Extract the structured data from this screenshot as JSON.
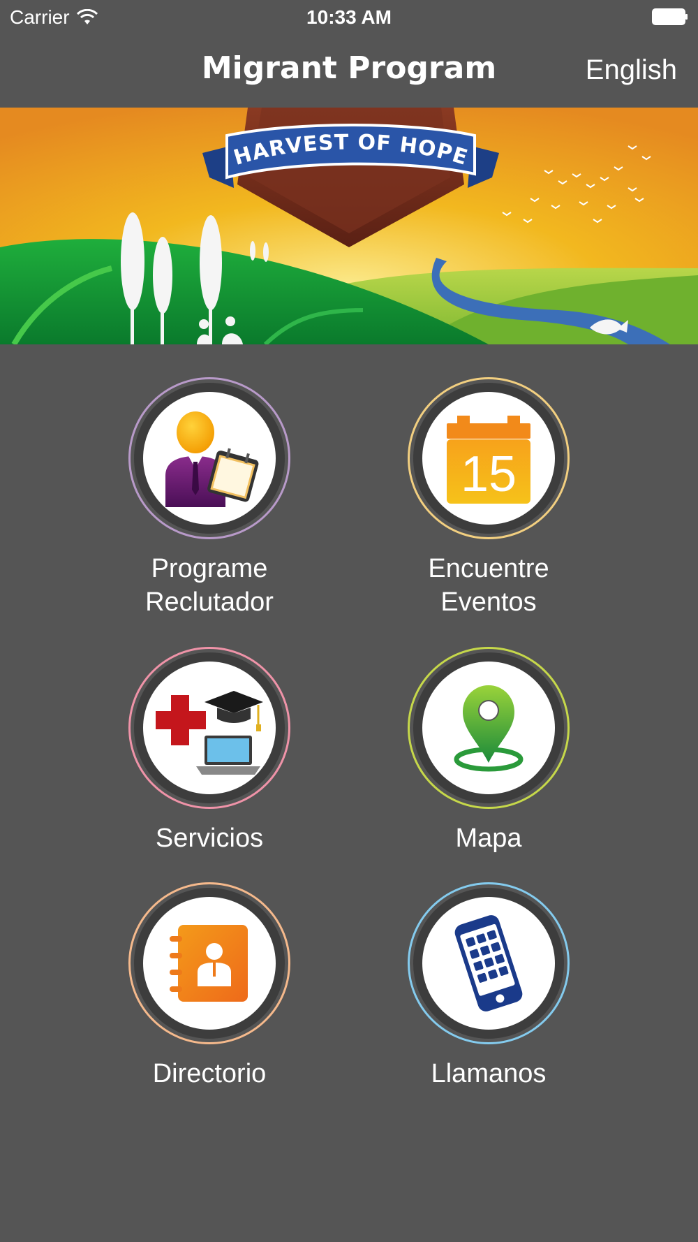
{
  "status": {
    "carrier": "Carrier",
    "time": "10:33 AM"
  },
  "nav": {
    "title": "Migrant Program",
    "language": "English"
  },
  "banner": {
    "text": "HARVEST OF HOPE"
  },
  "tiles": [
    {
      "line1": "Programe",
      "line2": "Reclutador",
      "ring_color": "#b89ac9",
      "icon": "recruiter-icon"
    },
    {
      "line1": "Encuentre",
      "line2": "Eventos",
      "ring_color": "#f2cf80",
      "icon": "calendar-icon",
      "calendar_day": "15"
    },
    {
      "line1": "Servicios",
      "ring_color": "#ef93a8",
      "icon": "services-icon"
    },
    {
      "line1": "Mapa",
      "ring_color": "#c6d84a",
      "icon": "map-pin-icon"
    },
    {
      "line1": "Directorio",
      "ring_color": "#f5b98c",
      "icon": "directory-icon"
    },
    {
      "line1": "Llamanos",
      "ring_color": "#84cbee",
      "icon": "phone-icon"
    }
  ],
  "colors": {
    "background": "#555555",
    "ring_dark": "#3d3d3d"
  }
}
